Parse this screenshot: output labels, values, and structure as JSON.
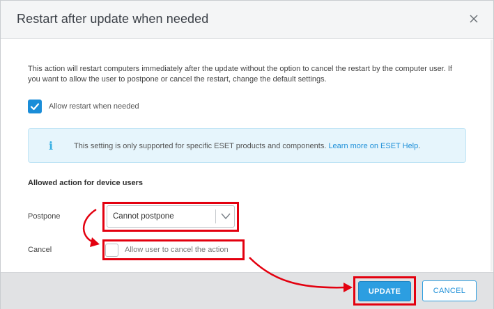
{
  "dialog": {
    "title": "Restart after update when needed",
    "close_icon": "close-icon"
  },
  "description": "This action will restart computers immediately after the update without the option to cancel the restart by the computer user. If you want to allow the user to postpone or cancel the restart, change the default settings.",
  "allow_restart": {
    "label": "Allow restart when needed",
    "checked": true
  },
  "info_box": {
    "icon": "i",
    "text": "This setting is only supported for specific ESET products and components.",
    "link": "Learn more on ESET Help",
    "link_suffix": "."
  },
  "section": {
    "heading": "Allowed action for device users"
  },
  "postpone": {
    "label": "Postpone",
    "selected": "Cannot postpone"
  },
  "cancel": {
    "label": "Cancel",
    "checkbox_label": "Allow user to cancel the action",
    "checked": false
  },
  "footer": {
    "update_label": "UPDATE",
    "cancel_label": "CANCEL"
  },
  "colors": {
    "accent": "#2c9ee1",
    "highlight": "#e3000f",
    "info_bg": "#e6f5fc"
  }
}
